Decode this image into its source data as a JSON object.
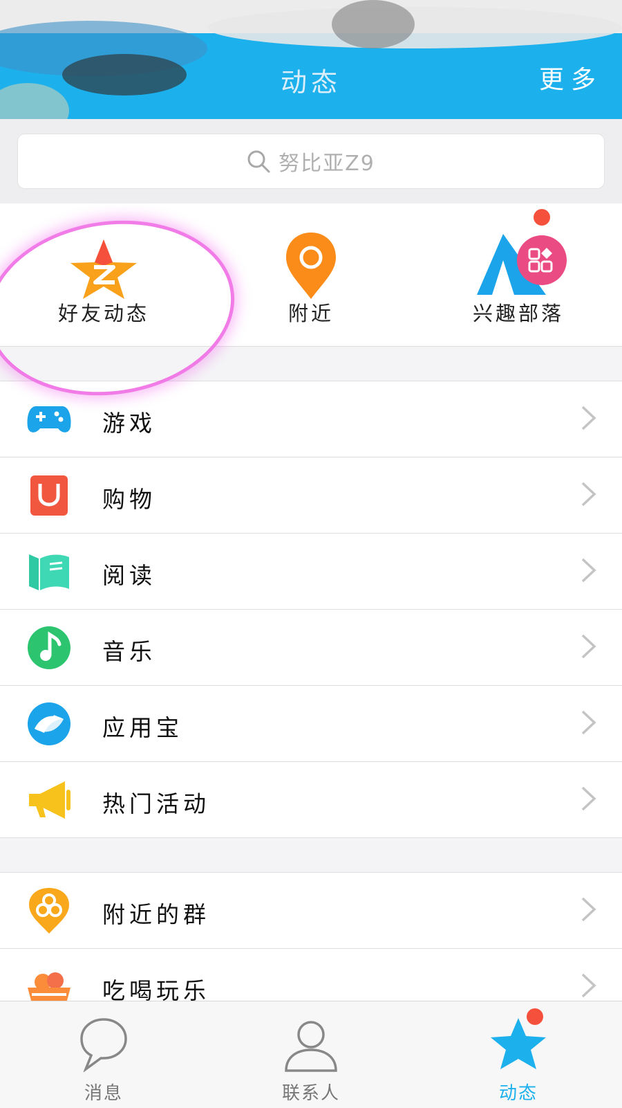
{
  "header": {
    "title": "动态",
    "more_label": "更多"
  },
  "search": {
    "placeholder": "努比亚Z9"
  },
  "quick_actions": [
    {
      "label": "好友动态",
      "icon": "qzone-star-icon"
    },
    {
      "label": "附近",
      "icon": "location-pin-icon"
    },
    {
      "label": "兴趣部落",
      "icon": "tribe-tent-icon"
    }
  ],
  "menu_section_1": [
    {
      "label": "游戏",
      "icon": "gamepad-icon"
    },
    {
      "label": "购物",
      "icon": "shopping-bag-icon"
    },
    {
      "label": "阅读",
      "icon": "book-icon"
    },
    {
      "label": "音乐",
      "icon": "music-icon"
    },
    {
      "label": "应用宝",
      "icon": "app-store-icon"
    },
    {
      "label": "热门活动",
      "icon": "megaphone-icon"
    }
  ],
  "menu_section_2": [
    {
      "label": "附近的群",
      "icon": "nearby-group-icon"
    },
    {
      "label": "吃喝玩乐",
      "icon": "food-basket-icon"
    }
  ],
  "tabbar": [
    {
      "label": "消息",
      "icon": "chat-bubble-icon",
      "active": false
    },
    {
      "label": "联系人",
      "icon": "contact-person-icon",
      "active": false
    },
    {
      "label": "动态",
      "icon": "star-icon",
      "active": true
    }
  ],
  "colors": {
    "brand": "#1cb0ec",
    "badge": "#f5503c",
    "highlight": "#f06ee6"
  }
}
